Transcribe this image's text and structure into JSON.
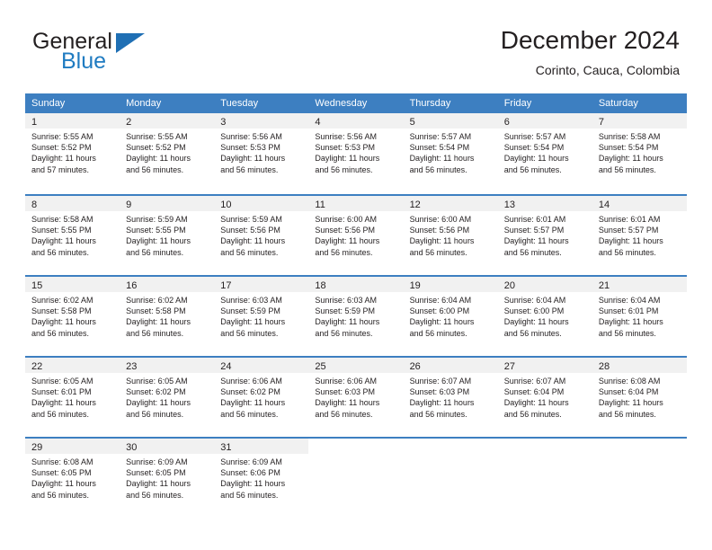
{
  "brand": {
    "name_top": "General",
    "name_bottom": "Blue",
    "flag_icon": "triangle-flag-icon",
    "accent_color": "#1f7bc1"
  },
  "header": {
    "title": "December 2024",
    "subtitle": "Corinto, Cauca, Colombia"
  },
  "theme": {
    "header_blue": "#3d7fc1",
    "day_number_bg": "#f1f1f1",
    "text_color": "#231f20"
  },
  "calendar": {
    "weekdays": [
      "Sunday",
      "Monday",
      "Tuesday",
      "Wednesday",
      "Thursday",
      "Friday",
      "Saturday"
    ],
    "weeks": [
      [
        {
          "day": "1",
          "sunrise": "Sunrise: 5:55 AM",
          "sunset": "Sunset: 5:52 PM",
          "daylight_1": "Daylight: 11 hours",
          "daylight_2": "and 57 minutes."
        },
        {
          "day": "2",
          "sunrise": "Sunrise: 5:55 AM",
          "sunset": "Sunset: 5:52 PM",
          "daylight_1": "Daylight: 11 hours",
          "daylight_2": "and 56 minutes."
        },
        {
          "day": "3",
          "sunrise": "Sunrise: 5:56 AM",
          "sunset": "Sunset: 5:53 PM",
          "daylight_1": "Daylight: 11 hours",
          "daylight_2": "and 56 minutes."
        },
        {
          "day": "4",
          "sunrise": "Sunrise: 5:56 AM",
          "sunset": "Sunset: 5:53 PM",
          "daylight_1": "Daylight: 11 hours",
          "daylight_2": "and 56 minutes."
        },
        {
          "day": "5",
          "sunrise": "Sunrise: 5:57 AM",
          "sunset": "Sunset: 5:54 PM",
          "daylight_1": "Daylight: 11 hours",
          "daylight_2": "and 56 minutes."
        },
        {
          "day": "6",
          "sunrise": "Sunrise: 5:57 AM",
          "sunset": "Sunset: 5:54 PM",
          "daylight_1": "Daylight: 11 hours",
          "daylight_2": "and 56 minutes."
        },
        {
          "day": "7",
          "sunrise": "Sunrise: 5:58 AM",
          "sunset": "Sunset: 5:54 PM",
          "daylight_1": "Daylight: 11 hours",
          "daylight_2": "and 56 minutes."
        }
      ],
      [
        {
          "day": "8",
          "sunrise": "Sunrise: 5:58 AM",
          "sunset": "Sunset: 5:55 PM",
          "daylight_1": "Daylight: 11 hours",
          "daylight_2": "and 56 minutes."
        },
        {
          "day": "9",
          "sunrise": "Sunrise: 5:59 AM",
          "sunset": "Sunset: 5:55 PM",
          "daylight_1": "Daylight: 11 hours",
          "daylight_2": "and 56 minutes."
        },
        {
          "day": "10",
          "sunrise": "Sunrise: 5:59 AM",
          "sunset": "Sunset: 5:56 PM",
          "daylight_1": "Daylight: 11 hours",
          "daylight_2": "and 56 minutes."
        },
        {
          "day": "11",
          "sunrise": "Sunrise: 6:00 AM",
          "sunset": "Sunset: 5:56 PM",
          "daylight_1": "Daylight: 11 hours",
          "daylight_2": "and 56 minutes."
        },
        {
          "day": "12",
          "sunrise": "Sunrise: 6:00 AM",
          "sunset": "Sunset: 5:56 PM",
          "daylight_1": "Daylight: 11 hours",
          "daylight_2": "and 56 minutes."
        },
        {
          "day": "13",
          "sunrise": "Sunrise: 6:01 AM",
          "sunset": "Sunset: 5:57 PM",
          "daylight_1": "Daylight: 11 hours",
          "daylight_2": "and 56 minutes."
        },
        {
          "day": "14",
          "sunrise": "Sunrise: 6:01 AM",
          "sunset": "Sunset: 5:57 PM",
          "daylight_1": "Daylight: 11 hours",
          "daylight_2": "and 56 minutes."
        }
      ],
      [
        {
          "day": "15",
          "sunrise": "Sunrise: 6:02 AM",
          "sunset": "Sunset: 5:58 PM",
          "daylight_1": "Daylight: 11 hours",
          "daylight_2": "and 56 minutes."
        },
        {
          "day": "16",
          "sunrise": "Sunrise: 6:02 AM",
          "sunset": "Sunset: 5:58 PM",
          "daylight_1": "Daylight: 11 hours",
          "daylight_2": "and 56 minutes."
        },
        {
          "day": "17",
          "sunrise": "Sunrise: 6:03 AM",
          "sunset": "Sunset: 5:59 PM",
          "daylight_1": "Daylight: 11 hours",
          "daylight_2": "and 56 minutes."
        },
        {
          "day": "18",
          "sunrise": "Sunrise: 6:03 AM",
          "sunset": "Sunset: 5:59 PM",
          "daylight_1": "Daylight: 11 hours",
          "daylight_2": "and 56 minutes."
        },
        {
          "day": "19",
          "sunrise": "Sunrise: 6:04 AM",
          "sunset": "Sunset: 6:00 PM",
          "daylight_1": "Daylight: 11 hours",
          "daylight_2": "and 56 minutes."
        },
        {
          "day": "20",
          "sunrise": "Sunrise: 6:04 AM",
          "sunset": "Sunset: 6:00 PM",
          "daylight_1": "Daylight: 11 hours",
          "daylight_2": "and 56 minutes."
        },
        {
          "day": "21",
          "sunrise": "Sunrise: 6:04 AM",
          "sunset": "Sunset: 6:01 PM",
          "daylight_1": "Daylight: 11 hours",
          "daylight_2": "and 56 minutes."
        }
      ],
      [
        {
          "day": "22",
          "sunrise": "Sunrise: 6:05 AM",
          "sunset": "Sunset: 6:01 PM",
          "daylight_1": "Daylight: 11 hours",
          "daylight_2": "and 56 minutes."
        },
        {
          "day": "23",
          "sunrise": "Sunrise: 6:05 AM",
          "sunset": "Sunset: 6:02 PM",
          "daylight_1": "Daylight: 11 hours",
          "daylight_2": "and 56 minutes."
        },
        {
          "day": "24",
          "sunrise": "Sunrise: 6:06 AM",
          "sunset": "Sunset: 6:02 PM",
          "daylight_1": "Daylight: 11 hours",
          "daylight_2": "and 56 minutes."
        },
        {
          "day": "25",
          "sunrise": "Sunrise: 6:06 AM",
          "sunset": "Sunset: 6:03 PM",
          "daylight_1": "Daylight: 11 hours",
          "daylight_2": "and 56 minutes."
        },
        {
          "day": "26",
          "sunrise": "Sunrise: 6:07 AM",
          "sunset": "Sunset: 6:03 PM",
          "daylight_1": "Daylight: 11 hours",
          "daylight_2": "and 56 minutes."
        },
        {
          "day": "27",
          "sunrise": "Sunrise: 6:07 AM",
          "sunset": "Sunset: 6:04 PM",
          "daylight_1": "Daylight: 11 hours",
          "daylight_2": "and 56 minutes."
        },
        {
          "day": "28",
          "sunrise": "Sunrise: 6:08 AM",
          "sunset": "Sunset: 6:04 PM",
          "daylight_1": "Daylight: 11 hours",
          "daylight_2": "and 56 minutes."
        }
      ],
      [
        {
          "day": "29",
          "sunrise": "Sunrise: 6:08 AM",
          "sunset": "Sunset: 6:05 PM",
          "daylight_1": "Daylight: 11 hours",
          "daylight_2": "and 56 minutes."
        },
        {
          "day": "30",
          "sunrise": "Sunrise: 6:09 AM",
          "sunset": "Sunset: 6:05 PM",
          "daylight_1": "Daylight: 11 hours",
          "daylight_2": "and 56 minutes."
        },
        {
          "day": "31",
          "sunrise": "Sunrise: 6:09 AM",
          "sunset": "Sunset: 6:06 PM",
          "daylight_1": "Daylight: 11 hours",
          "daylight_2": "and 56 minutes."
        },
        {
          "day": "",
          "sunrise": "",
          "sunset": "",
          "daylight_1": "",
          "daylight_2": ""
        },
        {
          "day": "",
          "sunrise": "",
          "sunset": "",
          "daylight_1": "",
          "daylight_2": ""
        },
        {
          "day": "",
          "sunrise": "",
          "sunset": "",
          "daylight_1": "",
          "daylight_2": ""
        },
        {
          "day": "",
          "sunrise": "",
          "sunset": "",
          "daylight_1": "",
          "daylight_2": ""
        }
      ]
    ]
  }
}
